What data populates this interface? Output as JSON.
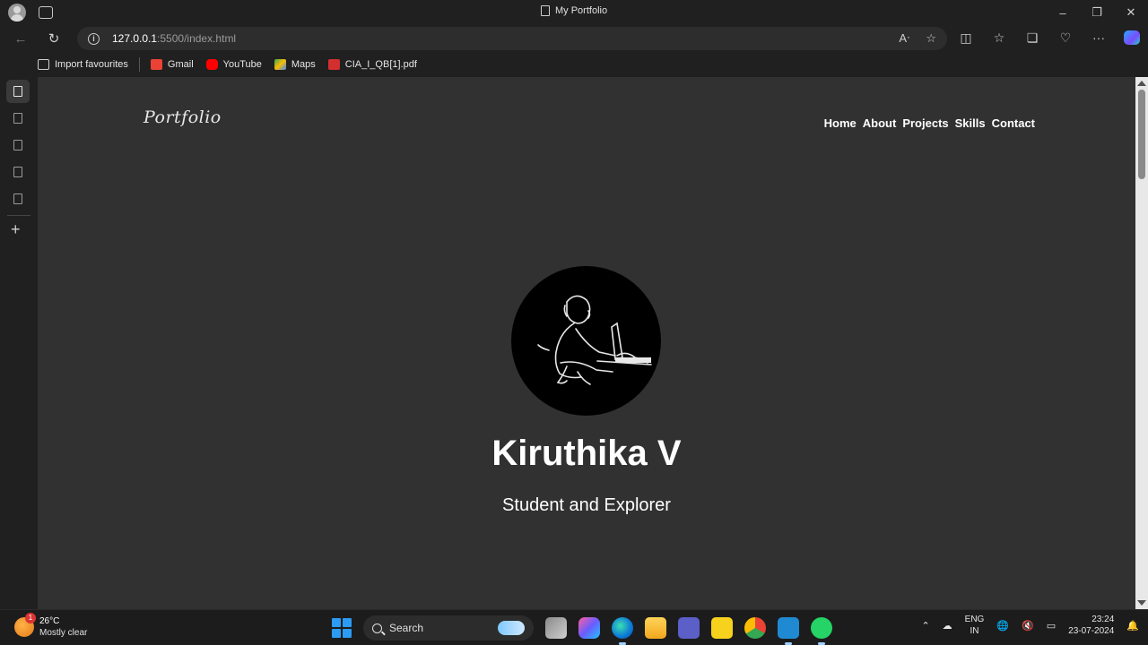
{
  "window": {
    "title": "My Portfolio",
    "controls": {
      "minimize": "–",
      "restore": "❐",
      "close": "✕"
    }
  },
  "address_bar": {
    "url_host": "127.0.0.1",
    "url_rest": ":5500/index.html"
  },
  "favourites": [
    {
      "label": "Import favourites",
      "color": "#cfcfcf"
    },
    {
      "label": "Gmail",
      "color": "#ea4335"
    },
    {
      "label": "YouTube",
      "color": "#ff0000"
    },
    {
      "label": "Maps",
      "color": "#34a853"
    },
    {
      "label": "CIA_I_QB[1].pdf",
      "color": "#d32f2f"
    }
  ],
  "page": {
    "logo": "Portfolio",
    "nav": [
      "Home",
      "About",
      "Projects",
      "Skills",
      "Contact"
    ],
    "hero_name": "Kiruthika V",
    "hero_subtitle": "Student and Explorer"
  },
  "taskbar": {
    "weather_temp": "26°C",
    "weather_condition": "Mostly clear",
    "weather_badge": "1",
    "search_label": "Search",
    "lang_top": "ENG",
    "lang_bottom": "IN",
    "time": "23:24",
    "date": "23-07-2024"
  }
}
